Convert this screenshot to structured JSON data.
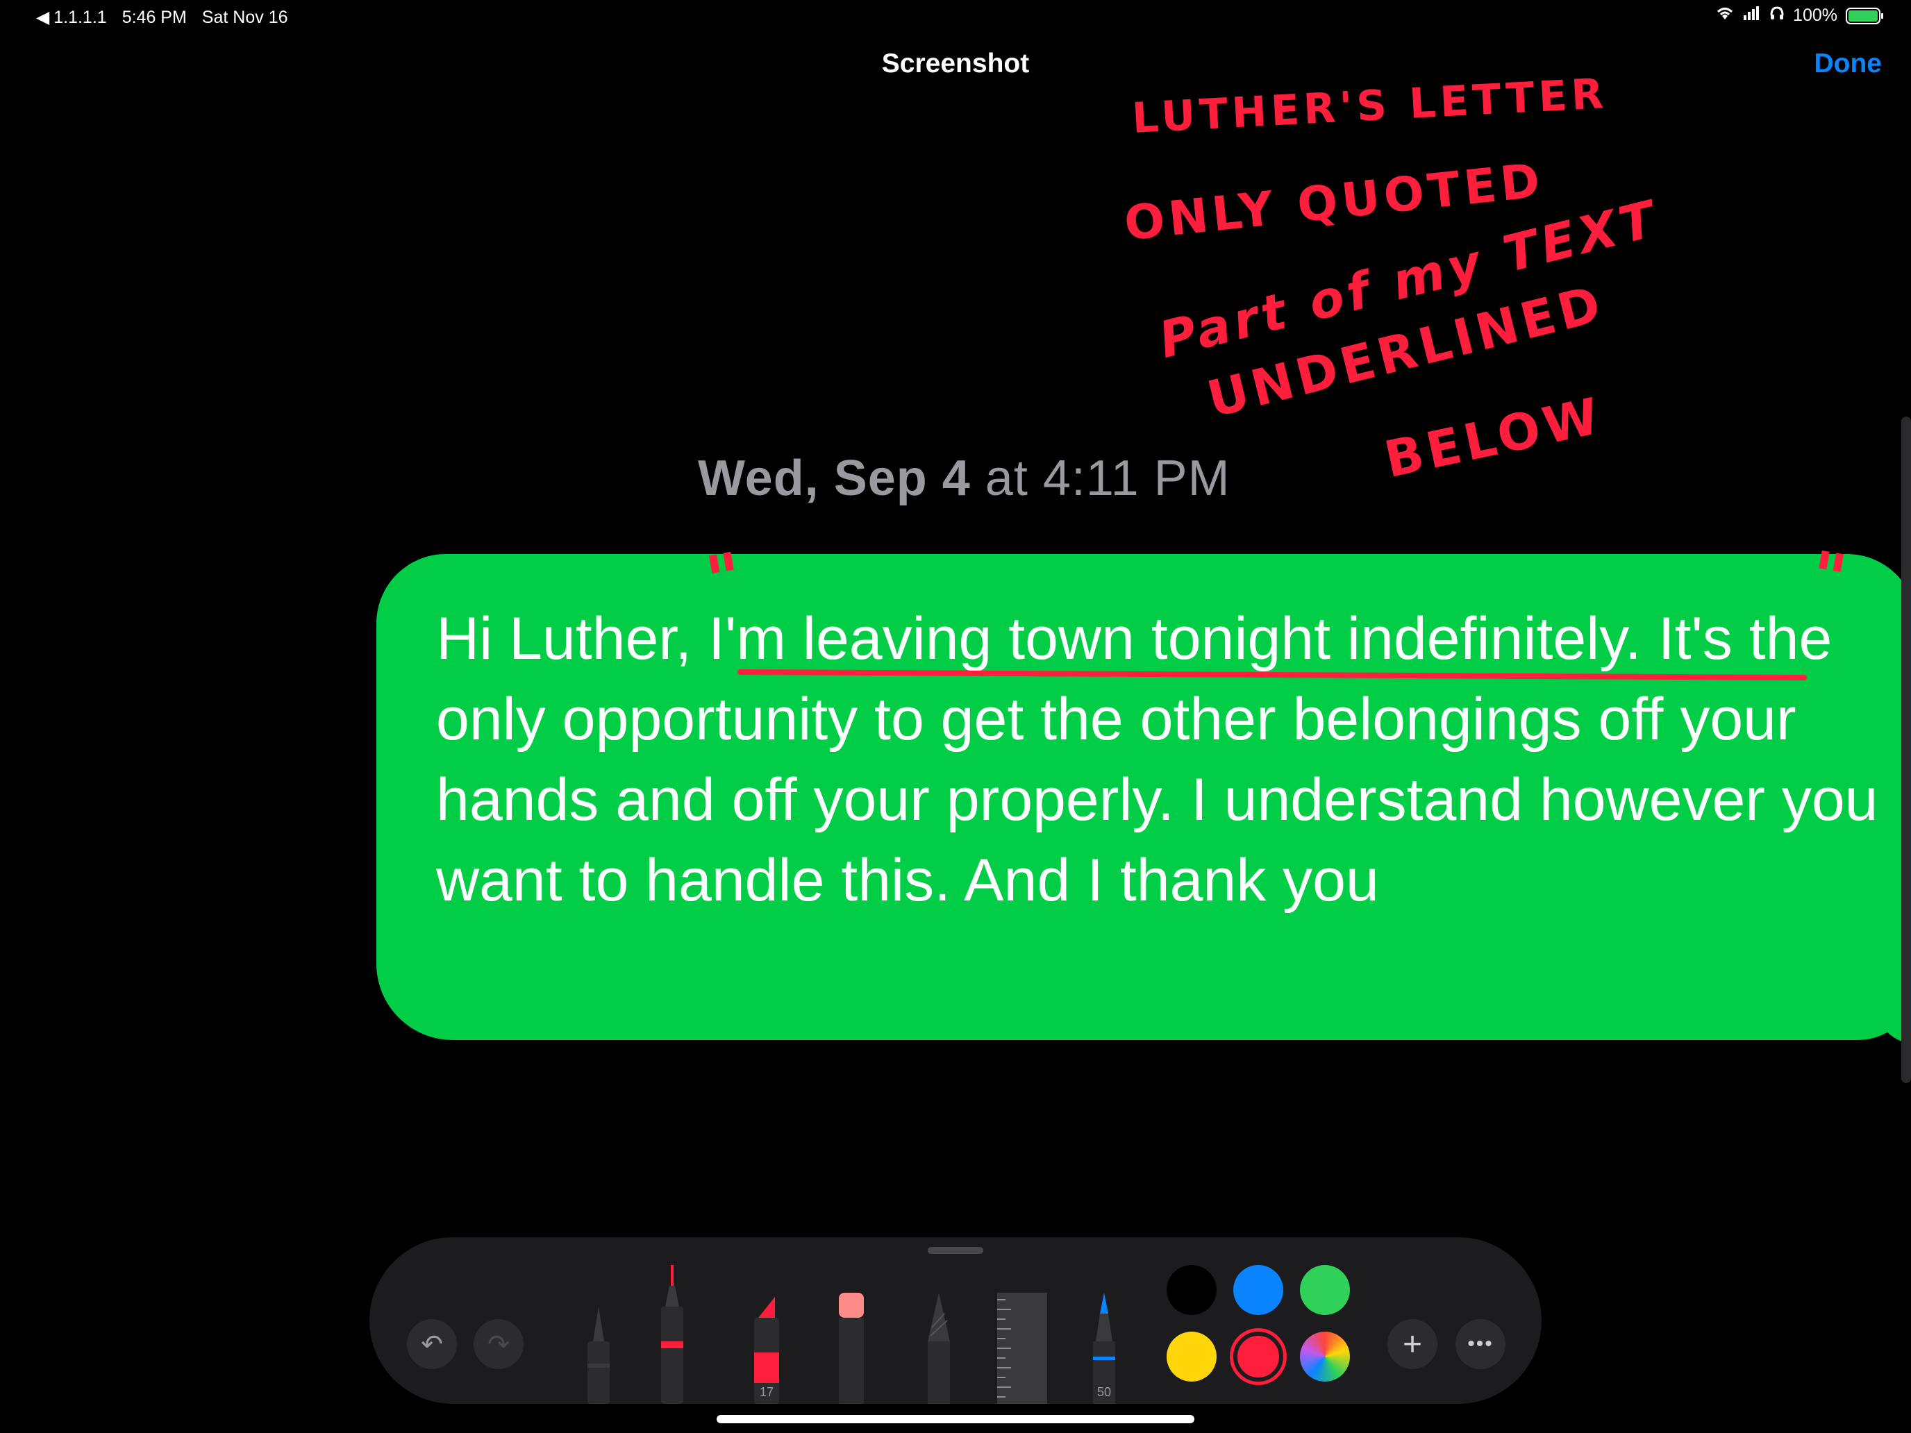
{
  "status_bar": {
    "back_label": "1.1.1.1",
    "time": "5:46 PM",
    "date": "Sat Nov 16",
    "battery_percent": "100%",
    "battery_level": 1.0,
    "battery_color": "#30d158"
  },
  "nav": {
    "title": "Screenshot",
    "done_label": "Done"
  },
  "conversation": {
    "timestamp_day": "Wed, Sep 4",
    "timestamp_time": "at 4:11 PM",
    "message_part1": "Hi Luther, ",
    "message_underlined": "I'm leaving town tonight indefinitely",
    "message_part2": ". It's the only opportunity to get the other belongings off your hands and off your properly. I understand however you want to handle this. And I thank you",
    "bubble_color": "#01cd47"
  },
  "annotations": {
    "line1": "Luther's Letter",
    "line2": "Only Quoted",
    "line3": "Part of my TEXT",
    "line4": "Underlined",
    "line5": "Below",
    "open_quote": "\"",
    "close_quote": "\"",
    "color": "#ff1f3c"
  },
  "toolbar": {
    "undo_icon": "↶",
    "redo_icon": "↷",
    "add_icon": "+",
    "more_icon": "•••",
    "marker_size": "17",
    "crayon_size": "50",
    "tools": [
      "pen",
      "monoline",
      "marker",
      "eraser",
      "pencil",
      "ruler",
      "watercolor"
    ],
    "selected_color": "red",
    "colors": [
      "#000000",
      "#0a84ff",
      "#30d158",
      "#ffd60a",
      "#ff1f3c",
      "multicolor"
    ]
  }
}
